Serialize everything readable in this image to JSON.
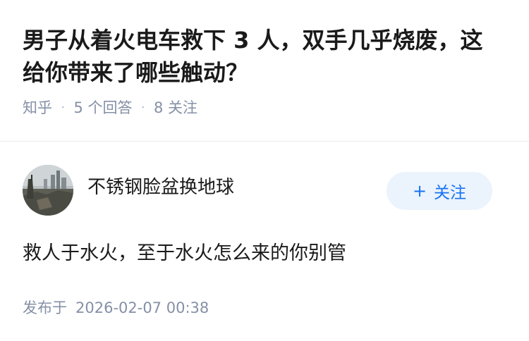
{
  "question": {
    "title": "男子从着火电车救下 3 人，双手几乎烧废，这给你带来了哪些触动？",
    "source": "知乎",
    "separator": "·",
    "answers": "5 个回答",
    "followers": "8 关注"
  },
  "answer": {
    "author": "不锈钢脸盆换地球",
    "follow_plus": "+",
    "follow_label": "关注",
    "content": "救人于水火，至于水火怎么来的你别管",
    "publish_prefix": "发布于",
    "publish_time": "2026-02-07 00:38"
  },
  "colors": {
    "accent": "#1772f6",
    "follow_bg": "#ebf3fd",
    "meta_text": "#8590a6"
  }
}
